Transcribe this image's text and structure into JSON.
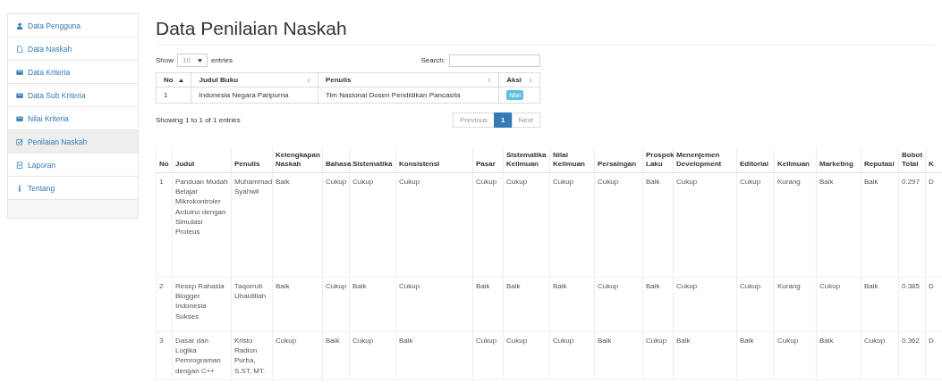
{
  "sidebar": {
    "items": [
      {
        "label": "Data Pengguna",
        "selected": false
      },
      {
        "label": "Data Naskah",
        "selected": false
      },
      {
        "label": "Data Kriteria",
        "selected": false
      },
      {
        "label": "Data Sub Kriteria",
        "selected": false
      },
      {
        "label": "Nilai Kriteria",
        "selected": false
      },
      {
        "label": "Penilaian Naskah",
        "selected": true
      },
      {
        "label": "Laporan",
        "selected": false
      },
      {
        "label": "Tentang",
        "selected": false
      }
    ]
  },
  "page_title": "Data Penilaian Naskah",
  "list_table": {
    "show_label": "Show",
    "page_size": "10",
    "entries_label": "entries",
    "search_label": "Search:",
    "columns": [
      {
        "label": "No",
        "sorted": true
      },
      {
        "label": "Judul Buku",
        "sorted": false
      },
      {
        "label": "Penulis",
        "sorted": false
      },
      {
        "label": "Aksi",
        "sorted": false
      }
    ],
    "rows": [
      {
        "no": "1",
        "title": "Indonesia Negara Paripurna",
        "author": "Tim Nasional Dosen Pendidikan Pancasila",
        "action": "Nilai"
      }
    ],
    "info": "Showing 1 to 1 of 1 entries",
    "pagination": [
      {
        "label": "Previous",
        "selected": false,
        "disabled": true
      },
      {
        "label": "1",
        "selected": true,
        "disabled": false
      },
      {
        "label": "Next",
        "selected": false,
        "disabled": true
      }
    ]
  },
  "result_table": {
    "columns": [
      "No",
      "Judul",
      "Penulis",
      "Kelengkapan Naskah",
      "Bahasa",
      "Sistematika",
      "Konsistensi",
      "Pasar",
      "Sistematika Keilmuan",
      "Nilai Keilmuan",
      "Persaingan",
      "Prospek Laku",
      "Menenjemen Development",
      "Editorial",
      "Keilmuan",
      "Marketing",
      "Reputasi",
      "Bobot Total",
      "K"
    ],
    "rows": [
      [
        "1",
        "Panduan Mudah Belajar Mikrokontroler Arduino dengan Simulasi Proteus",
        "Muhammad Syahwil",
        "Baik",
        "Cukup",
        "Cukup",
        "Cukup",
        "Cukup",
        "Cukup",
        "Cukup",
        "Cukup",
        "Baik",
        "Cukup",
        "Cukup",
        "Kurang",
        "Baik",
        "Baik",
        "0.297",
        "D"
      ],
      [
        "2",
        "Resep Rahasia Blogger Indonesia Sukses",
        "Taqorrub Ubaidillah",
        "Baik",
        "Cukup",
        "Baik",
        "Cukup",
        "Baik",
        "Baik",
        "Baik",
        "Cukup",
        "Baik",
        "Cukup",
        "Cukup",
        "Kurang",
        "Cukup",
        "Baik",
        "0.385",
        "D"
      ],
      [
        "3",
        "Dasar dan Logika Pemrograman dengan C++",
        "Kristo Radion Purba, S.ST, MT.",
        "Cukup",
        "Baik",
        "Cukup",
        "Baik",
        "Cukup",
        "Cukup",
        "Cukup",
        "Baik",
        "Cukup",
        "Baik",
        "Baik",
        "Cukup",
        "Baik",
        "Cukup",
        "0.362",
        "D"
      ]
    ]
  }
}
